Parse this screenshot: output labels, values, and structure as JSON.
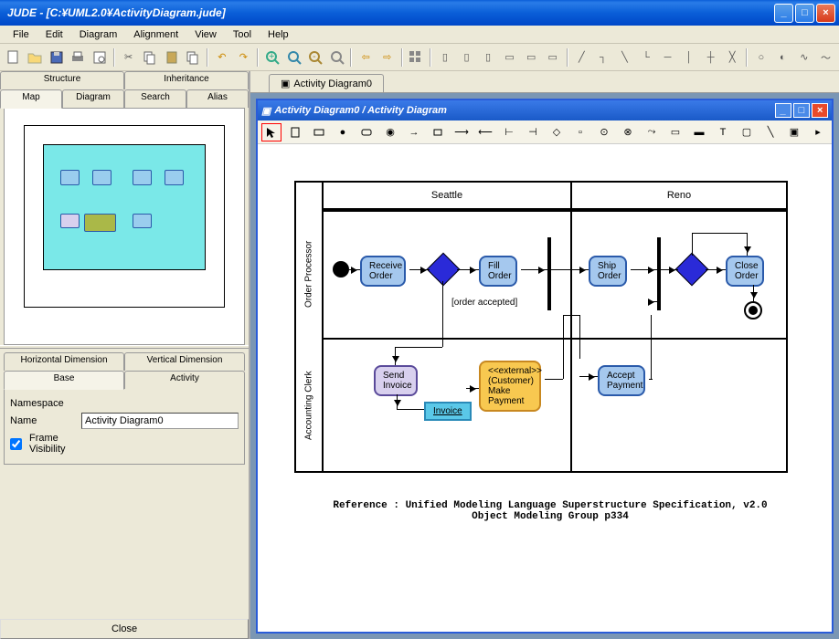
{
  "window": {
    "title": "JUDE - [C:¥UML2.0¥ActivityDiagram.jude]"
  },
  "menu": [
    "File",
    "Edit",
    "Diagram",
    "Alignment",
    "View",
    "Tool",
    "Help"
  ],
  "left": {
    "top_tabs": {
      "structure": "Structure",
      "inheritance": "Inheritance"
    },
    "sub_tabs": {
      "map": "Map",
      "diagram": "Diagram",
      "search": "Search",
      "alias": "Alias"
    },
    "prop_tabs": {
      "hdim": "Horizontal Dimension",
      "vdim": "Vertical Dimension",
      "base": "Base",
      "activity": "Activity"
    },
    "namespace_label": "Namespace",
    "name_label": "Name",
    "name_value": "Activity Diagram0",
    "frame_vis": "Frame Visibility",
    "close": "Close"
  },
  "doc": {
    "tab": "Activity Diagram0",
    "title": "Activity Diagram0 / Activity Diagram"
  },
  "diagram": {
    "partitions": {
      "seattle": "Seattle",
      "reno": "Reno"
    },
    "lanes": {
      "op": "Order Processor",
      "ac": "Accounting Clerk"
    },
    "nodes": {
      "receive": "Receive\nOrder",
      "fill": "Fill\nOrder",
      "ship": "Ship\nOrder",
      "close": "Close\nOrder",
      "send": "Send\nInvoice",
      "invoice": "Invoice",
      "payment": "<<external>>\n(Customer)\nMake\nPayment",
      "accept": "Accept\nPayment"
    },
    "guard": "[order accepted]",
    "reference": "Reference : Unified Modeling Language Superstructure Specification, v2.0\nObject Modeling Group p334"
  }
}
